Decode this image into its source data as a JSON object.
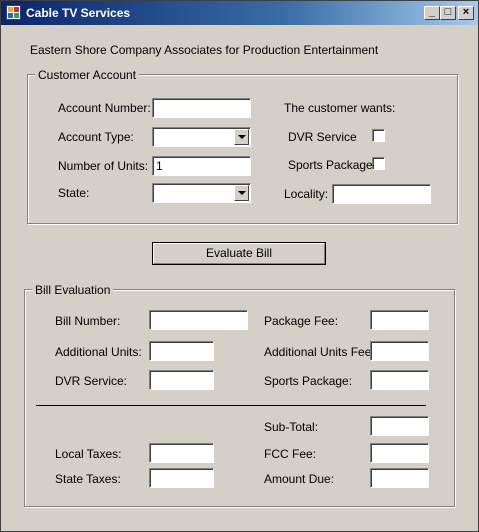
{
  "window": {
    "title": "Cable TV Services",
    "controls": {
      "minimize": "_",
      "maximize": "□",
      "close": "×"
    }
  },
  "company_name": "Eastern Shore Company Associates for Production Entertainment",
  "customer_account": {
    "group_title": "Customer Account",
    "account_number_label": "Account Number:",
    "account_number_value": "",
    "account_type_label": "Account Type:",
    "account_type_value": "",
    "units_label": "Number of Units:",
    "units_value": "1",
    "state_label": "State:",
    "state_value": "",
    "wants_label": "The customer wants:",
    "dvr_label": "DVR Service",
    "dvr_checked": false,
    "sports_label": "Sports Package",
    "sports_checked": false,
    "locality_label": "Locality:",
    "locality_value": ""
  },
  "evaluate_button": "Evaluate Bill",
  "bill_evaluation": {
    "group_title": "Bill Evaluation",
    "bill_number_label": "Bill Number:",
    "bill_number_value": "",
    "additional_units_label": "Additional Units:",
    "additional_units_value": "",
    "dvr_service_label": "DVR Service:",
    "dvr_service_value": "",
    "package_fee_label": "Package Fee:",
    "package_fee_value": "",
    "additional_units_fee_label": "Additional Units Fee:",
    "additional_units_fee_value": "",
    "sports_package_label": "Sports Package:",
    "sports_package_value": "",
    "subtotal_label": "Sub-Total:",
    "subtotal_value": "",
    "local_taxes_label": "Local Taxes:",
    "local_taxes_value": "",
    "state_taxes_label": "State Taxes:",
    "state_taxes_value": "",
    "fcc_fee_label": "FCC Fee:",
    "fcc_fee_value": "",
    "amount_due_label": "Amount Due:",
    "amount_due_value": ""
  }
}
